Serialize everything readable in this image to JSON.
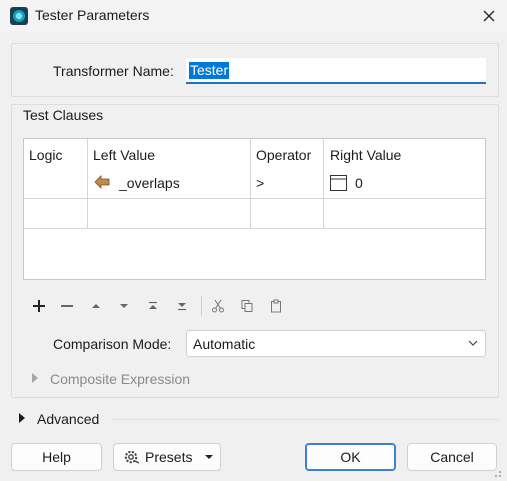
{
  "window": {
    "title": "Tester Parameters"
  },
  "transformer_name": {
    "label": "Transformer Name:",
    "value": "Tester"
  },
  "test_clauses": {
    "title": "Test Clauses",
    "columns": [
      "Logic",
      "Left Value",
      "Operator",
      "Right Value"
    ],
    "rows": [
      {
        "logic": "",
        "left_value": "_overlaps",
        "operator": ">",
        "right_value": "0"
      }
    ]
  },
  "toolbar": {
    "icons": [
      "add-icon",
      "remove-icon",
      "move-up-icon",
      "move-down-icon",
      "move-top-icon",
      "move-bottom-icon",
      "cut-icon",
      "copy-icon",
      "paste-icon"
    ]
  },
  "comparison_mode": {
    "label": "Comparison Mode:",
    "value": "Automatic"
  },
  "composite_expression": {
    "label": "Composite Expression"
  },
  "advanced": {
    "label": "Advanced"
  },
  "buttons": {
    "help": "Help",
    "presets": "Presets",
    "ok": "OK",
    "cancel": "Cancel"
  },
  "colors": {
    "accent": "#0078d7",
    "disabled_text": "#8a8a8a"
  }
}
